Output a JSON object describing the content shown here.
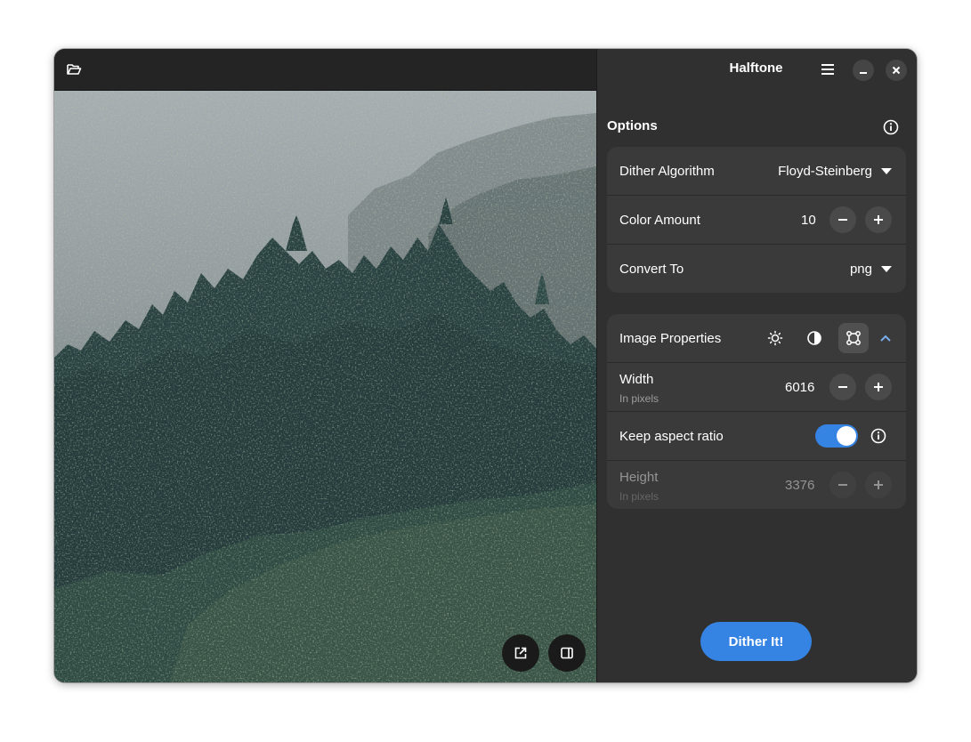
{
  "window": {
    "title": "Halftone"
  },
  "left_header": {
    "open_icon": "folder-open-icon"
  },
  "image_overlay": {
    "open_external_icon": "external-link-icon",
    "sidebar_toggle_icon": "sidebar-toggle-icon"
  },
  "header_buttons": {
    "menu_icon": "hamburger-menu-icon",
    "minimize_icon": "minimize-icon",
    "close_icon": "close-icon"
  },
  "options": {
    "label": "Options",
    "info_icon": "info-icon",
    "dither_algorithm": {
      "label": "Dither Algorithm",
      "value": "Floyd-Steinberg"
    },
    "color_amount": {
      "label": "Color Amount",
      "value": "10"
    },
    "convert_to": {
      "label": "Convert To",
      "value": "png"
    }
  },
  "image_properties": {
    "label": "Image Properties",
    "icons": [
      "brightness-icon",
      "contrast-icon",
      "resize-icon",
      "chevron-up-icon"
    ],
    "width": {
      "label": "Width",
      "sublabel": "In pixels",
      "value": "6016"
    },
    "keep_aspect_ratio": {
      "label": "Keep aspect ratio",
      "enabled": true
    },
    "height": {
      "label": "Height",
      "sublabel": "In pixels",
      "value": "3376"
    }
  },
  "actions": {
    "dither_label": "Dither It!"
  },
  "colors": {
    "accent": "#3584e4",
    "panel_bg": "#303030",
    "card_bg": "#3a3a3a",
    "forest_dark": "#0f2a2a",
    "fog": "#8c9698"
  }
}
